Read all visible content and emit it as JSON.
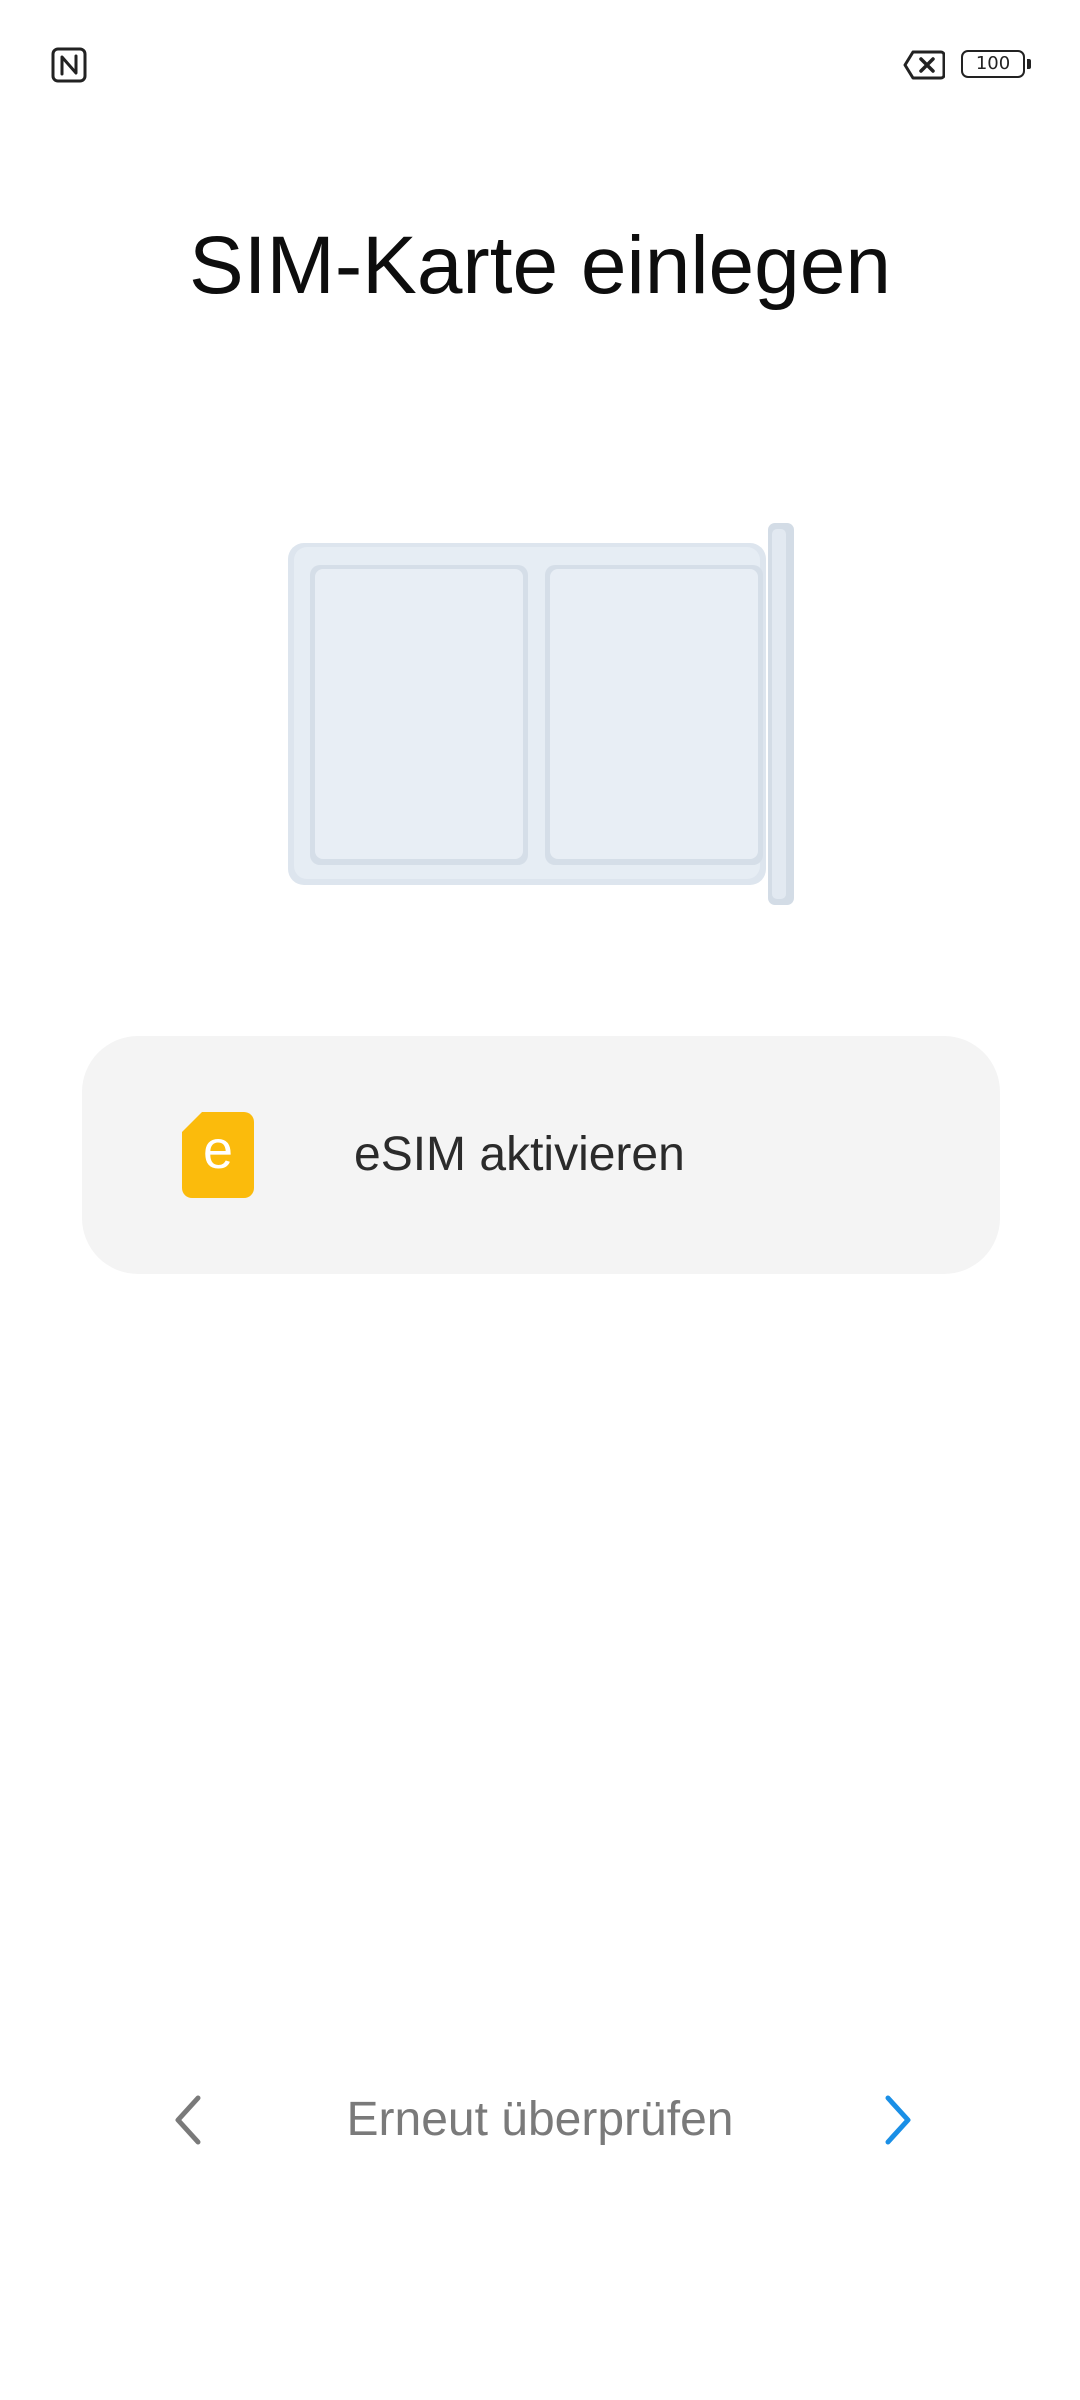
{
  "status_bar": {
    "left_icons": [
      "nfc-icon"
    ],
    "right_icons": [
      "no-sim-icon",
      "battery-icon"
    ],
    "battery_level": "100"
  },
  "page": {
    "title": "SIM-Karte einlegen"
  },
  "illustration": {
    "name": "sim-tray-illustration",
    "color": "#e3eaf2"
  },
  "esim_option": {
    "icon": "esim-icon",
    "icon_letter": "e",
    "icon_color": "#fbbb0c",
    "label": "eSIM aktivieren"
  },
  "navigation": {
    "back_icon": "chevron-left-icon",
    "retry_label": "Erneut überprüfen",
    "next_icon": "chevron-right-icon",
    "accent_color": "#1a8fe6"
  }
}
